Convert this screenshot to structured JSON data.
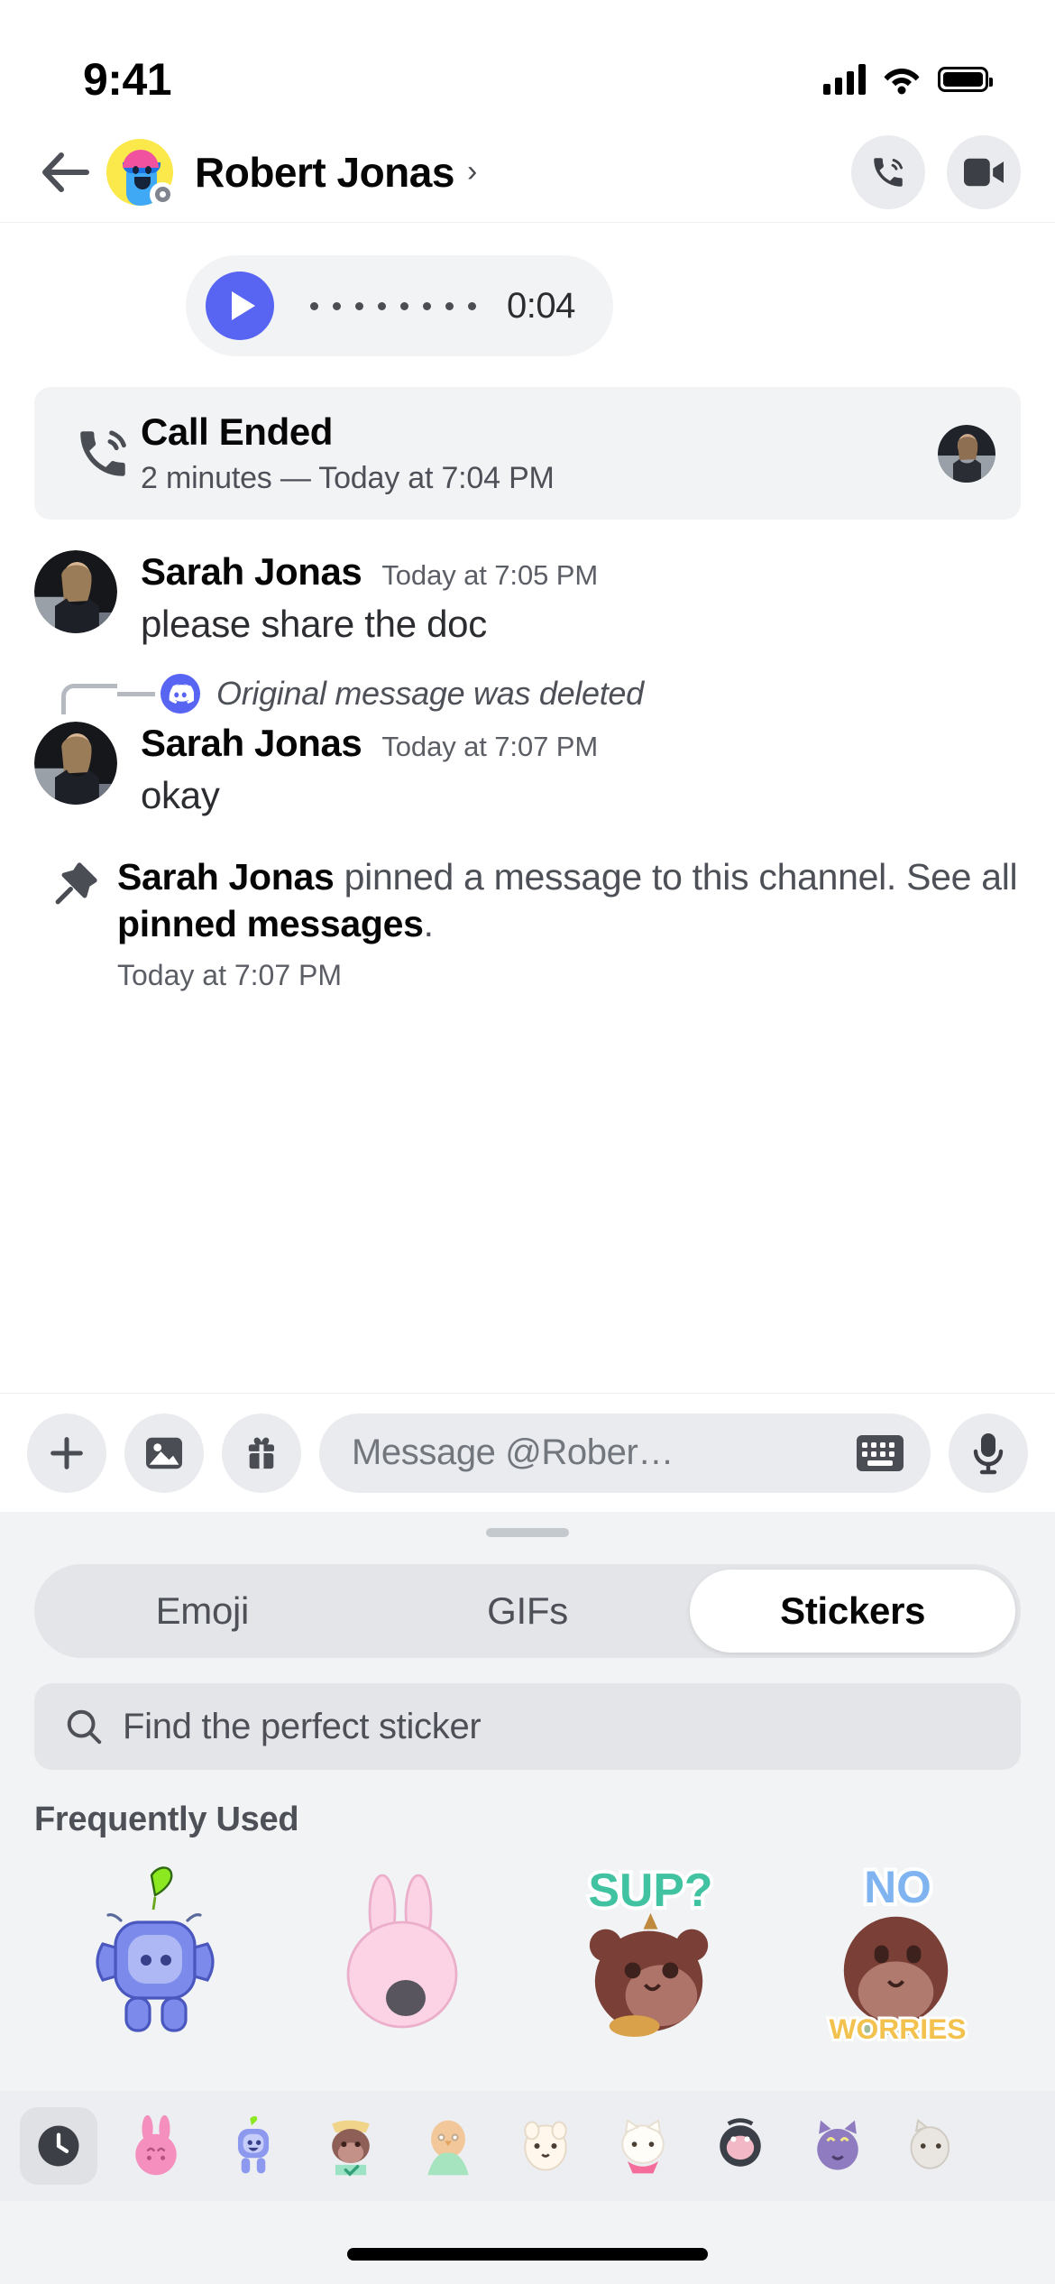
{
  "status_bar": {
    "time": "9:41",
    "signal_icon": "cellular-signal-icon",
    "wifi_icon": "wifi-icon",
    "battery_icon": "battery-icon"
  },
  "header": {
    "back_icon": "back-arrow-icon",
    "avatar_icon": "user-avatar",
    "title": "Robert Jonas",
    "chevron": "›",
    "voice_call_icon": "phone-call-icon",
    "video_call_icon": "video-camera-icon"
  },
  "conversation": {
    "voice_message": {
      "play_icon": "play-icon",
      "duration": "0:04",
      "waveform_bars": 8
    },
    "call_ended": {
      "icon": "phone-call-icon",
      "title": "Call Ended",
      "subtitle": "2 minutes — Today at 7:04 PM",
      "avatar": "sarah-avatar"
    },
    "messages": [
      {
        "author": "Sarah Jonas",
        "timestamp": "Today at 7:05 PM",
        "text": "please share the doc"
      },
      {
        "author": "Sarah Jonas",
        "timestamp": "Today at 7:07 PM",
        "text": "okay"
      }
    ],
    "reply_reference": {
      "icon": "discord-logo-icon",
      "text": "Original message was deleted"
    },
    "pinned_notice": {
      "icon": "pin-icon",
      "author": "Sarah Jonas",
      "middle": " pinned a message to this channel. See all ",
      "link": "pinned messages",
      "suffix": ".",
      "timestamp": "Today at 7:07 PM"
    }
  },
  "input_bar": {
    "add_icon": "plus-icon",
    "gallery_icon": "image-icon",
    "gift_icon": "gift-icon",
    "placeholder": "Message @Rober…",
    "keyboard_icon": "keyboard-icon",
    "mic_icon": "microphone-icon"
  },
  "sticker_drawer": {
    "grabber": "drag-handle",
    "tabs": [
      {
        "label": "Emoji",
        "active": false
      },
      {
        "label": "GIFs",
        "active": false
      },
      {
        "label": "Stickers",
        "active": true
      }
    ],
    "search": {
      "icon": "search-icon",
      "placeholder": "Find the perfect sticker"
    },
    "section_title": "Frequently Used",
    "stickers": [
      {
        "name": "blue-wumpus-leaf-sticker",
        "caption": ""
      },
      {
        "name": "pink-bunny-sticker",
        "caption": ""
      },
      {
        "name": "brown-bear-sup-sticker",
        "caption": "SUP?"
      },
      {
        "name": "brown-bear-no-worries-sticker",
        "caption": "NO WORRIES"
      }
    ],
    "packs": [
      {
        "name": "recent-clock-pack",
        "selected": true
      },
      {
        "name": "pink-bunny-pack",
        "selected": false
      },
      {
        "name": "blue-wumpus-pack",
        "selected": false
      },
      {
        "name": "brown-bear-pack",
        "selected": false
      },
      {
        "name": "green-bird-pack",
        "selected": false
      },
      {
        "name": "white-hamster-pack",
        "selected": false
      },
      {
        "name": "white-cat-pack",
        "selected": false
      },
      {
        "name": "dark-ghost-pack",
        "selected": false
      },
      {
        "name": "purple-cat-pack",
        "selected": false
      },
      {
        "name": "grey-cat-pack",
        "selected": false
      }
    ]
  },
  "colors": {
    "brand": "#5865F2",
    "panel": "#f2f3f5",
    "control": "#eaebee",
    "text_primary": "#060607",
    "text_muted": "#4e5058"
  }
}
